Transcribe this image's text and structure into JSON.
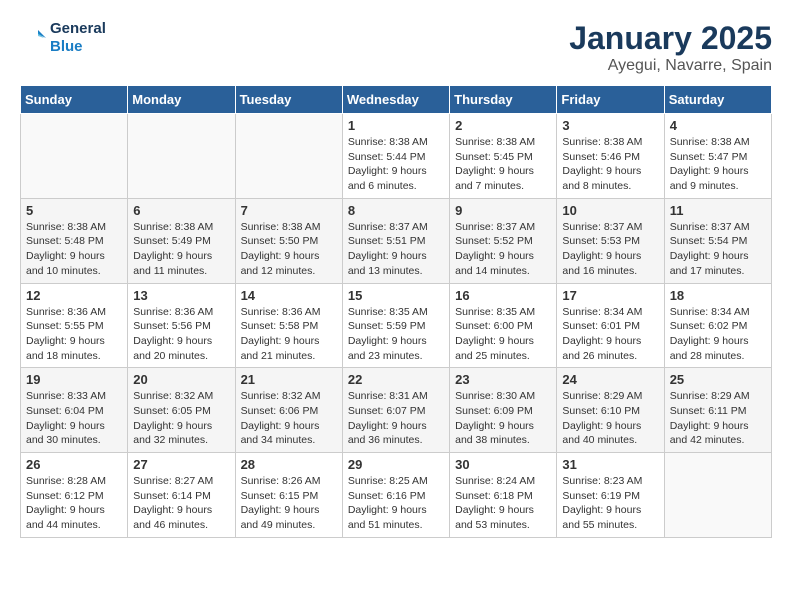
{
  "header": {
    "logo_line1": "General",
    "logo_line2": "Blue",
    "title": "January 2025",
    "subtitle": "Ayegui, Navarre, Spain"
  },
  "weekdays": [
    "Sunday",
    "Monday",
    "Tuesday",
    "Wednesday",
    "Thursday",
    "Friday",
    "Saturday"
  ],
  "weeks": [
    [
      {
        "day": "",
        "sunrise": "",
        "sunset": "",
        "daylight": ""
      },
      {
        "day": "",
        "sunrise": "",
        "sunset": "",
        "daylight": ""
      },
      {
        "day": "",
        "sunrise": "",
        "sunset": "",
        "daylight": ""
      },
      {
        "day": "1",
        "sunrise": "Sunrise: 8:38 AM",
        "sunset": "Sunset: 5:44 PM",
        "daylight": "Daylight: 9 hours and 6 minutes."
      },
      {
        "day": "2",
        "sunrise": "Sunrise: 8:38 AM",
        "sunset": "Sunset: 5:45 PM",
        "daylight": "Daylight: 9 hours and 7 minutes."
      },
      {
        "day": "3",
        "sunrise": "Sunrise: 8:38 AM",
        "sunset": "Sunset: 5:46 PM",
        "daylight": "Daylight: 9 hours and 8 minutes."
      },
      {
        "day": "4",
        "sunrise": "Sunrise: 8:38 AM",
        "sunset": "Sunset: 5:47 PM",
        "daylight": "Daylight: 9 hours and 9 minutes."
      }
    ],
    [
      {
        "day": "5",
        "sunrise": "Sunrise: 8:38 AM",
        "sunset": "Sunset: 5:48 PM",
        "daylight": "Daylight: 9 hours and 10 minutes."
      },
      {
        "day": "6",
        "sunrise": "Sunrise: 8:38 AM",
        "sunset": "Sunset: 5:49 PM",
        "daylight": "Daylight: 9 hours and 11 minutes."
      },
      {
        "day": "7",
        "sunrise": "Sunrise: 8:38 AM",
        "sunset": "Sunset: 5:50 PM",
        "daylight": "Daylight: 9 hours and 12 minutes."
      },
      {
        "day": "8",
        "sunrise": "Sunrise: 8:37 AM",
        "sunset": "Sunset: 5:51 PM",
        "daylight": "Daylight: 9 hours and 13 minutes."
      },
      {
        "day": "9",
        "sunrise": "Sunrise: 8:37 AM",
        "sunset": "Sunset: 5:52 PM",
        "daylight": "Daylight: 9 hours and 14 minutes."
      },
      {
        "day": "10",
        "sunrise": "Sunrise: 8:37 AM",
        "sunset": "Sunset: 5:53 PM",
        "daylight": "Daylight: 9 hours and 16 minutes."
      },
      {
        "day": "11",
        "sunrise": "Sunrise: 8:37 AM",
        "sunset": "Sunset: 5:54 PM",
        "daylight": "Daylight: 9 hours and 17 minutes."
      }
    ],
    [
      {
        "day": "12",
        "sunrise": "Sunrise: 8:36 AM",
        "sunset": "Sunset: 5:55 PM",
        "daylight": "Daylight: 9 hours and 18 minutes."
      },
      {
        "day": "13",
        "sunrise": "Sunrise: 8:36 AM",
        "sunset": "Sunset: 5:56 PM",
        "daylight": "Daylight: 9 hours and 20 minutes."
      },
      {
        "day": "14",
        "sunrise": "Sunrise: 8:36 AM",
        "sunset": "Sunset: 5:58 PM",
        "daylight": "Daylight: 9 hours and 21 minutes."
      },
      {
        "day": "15",
        "sunrise": "Sunrise: 8:35 AM",
        "sunset": "Sunset: 5:59 PM",
        "daylight": "Daylight: 9 hours and 23 minutes."
      },
      {
        "day": "16",
        "sunrise": "Sunrise: 8:35 AM",
        "sunset": "Sunset: 6:00 PM",
        "daylight": "Daylight: 9 hours and 25 minutes."
      },
      {
        "day": "17",
        "sunrise": "Sunrise: 8:34 AM",
        "sunset": "Sunset: 6:01 PM",
        "daylight": "Daylight: 9 hours and 26 minutes."
      },
      {
        "day": "18",
        "sunrise": "Sunrise: 8:34 AM",
        "sunset": "Sunset: 6:02 PM",
        "daylight": "Daylight: 9 hours and 28 minutes."
      }
    ],
    [
      {
        "day": "19",
        "sunrise": "Sunrise: 8:33 AM",
        "sunset": "Sunset: 6:04 PM",
        "daylight": "Daylight: 9 hours and 30 minutes."
      },
      {
        "day": "20",
        "sunrise": "Sunrise: 8:32 AM",
        "sunset": "Sunset: 6:05 PM",
        "daylight": "Daylight: 9 hours and 32 minutes."
      },
      {
        "day": "21",
        "sunrise": "Sunrise: 8:32 AM",
        "sunset": "Sunset: 6:06 PM",
        "daylight": "Daylight: 9 hours and 34 minutes."
      },
      {
        "day": "22",
        "sunrise": "Sunrise: 8:31 AM",
        "sunset": "Sunset: 6:07 PM",
        "daylight": "Daylight: 9 hours and 36 minutes."
      },
      {
        "day": "23",
        "sunrise": "Sunrise: 8:30 AM",
        "sunset": "Sunset: 6:09 PM",
        "daylight": "Daylight: 9 hours and 38 minutes."
      },
      {
        "day": "24",
        "sunrise": "Sunrise: 8:29 AM",
        "sunset": "Sunset: 6:10 PM",
        "daylight": "Daylight: 9 hours and 40 minutes."
      },
      {
        "day": "25",
        "sunrise": "Sunrise: 8:29 AM",
        "sunset": "Sunset: 6:11 PM",
        "daylight": "Daylight: 9 hours and 42 minutes."
      }
    ],
    [
      {
        "day": "26",
        "sunrise": "Sunrise: 8:28 AM",
        "sunset": "Sunset: 6:12 PM",
        "daylight": "Daylight: 9 hours and 44 minutes."
      },
      {
        "day": "27",
        "sunrise": "Sunrise: 8:27 AM",
        "sunset": "Sunset: 6:14 PM",
        "daylight": "Daylight: 9 hours and 46 minutes."
      },
      {
        "day": "28",
        "sunrise": "Sunrise: 8:26 AM",
        "sunset": "Sunset: 6:15 PM",
        "daylight": "Daylight: 9 hours and 49 minutes."
      },
      {
        "day": "29",
        "sunrise": "Sunrise: 8:25 AM",
        "sunset": "Sunset: 6:16 PM",
        "daylight": "Daylight: 9 hours and 51 minutes."
      },
      {
        "day": "30",
        "sunrise": "Sunrise: 8:24 AM",
        "sunset": "Sunset: 6:18 PM",
        "daylight": "Daylight: 9 hours and 53 minutes."
      },
      {
        "day": "31",
        "sunrise": "Sunrise: 8:23 AM",
        "sunset": "Sunset: 6:19 PM",
        "daylight": "Daylight: 9 hours and 55 minutes."
      },
      {
        "day": "",
        "sunrise": "",
        "sunset": "",
        "daylight": ""
      }
    ]
  ]
}
